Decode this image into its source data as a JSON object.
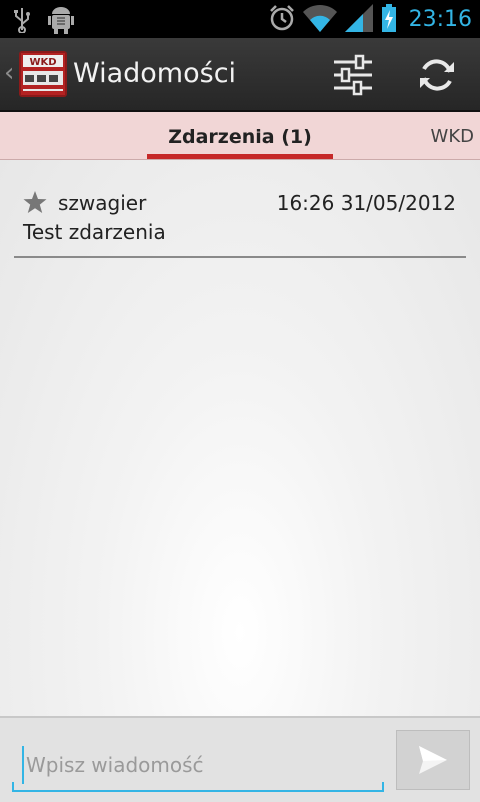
{
  "status_bar": {
    "time": "23:16",
    "icons": [
      "usb-icon",
      "android-debug-icon",
      "alarm-icon",
      "wifi-icon",
      "signal-icon",
      "battery-charging-icon"
    ]
  },
  "action_bar": {
    "title": "Wiadomości",
    "app_icon_text": "WKD",
    "buttons": [
      "settings-sliders-icon",
      "refresh-icon"
    ]
  },
  "tabs": {
    "current": "Zdarzenia (1)",
    "next": "WKD"
  },
  "messages": [
    {
      "sender": "szwagier",
      "time": "16:26 31/05/2012",
      "text": "Test zdarzenia",
      "starred": true
    }
  ],
  "compose": {
    "placeholder": "Wpisz wiadomość",
    "value": ""
  },
  "colors": {
    "accent": "#33b5e5",
    "tab_indicator": "#c62828",
    "tab_background": "#f1d6d6"
  }
}
